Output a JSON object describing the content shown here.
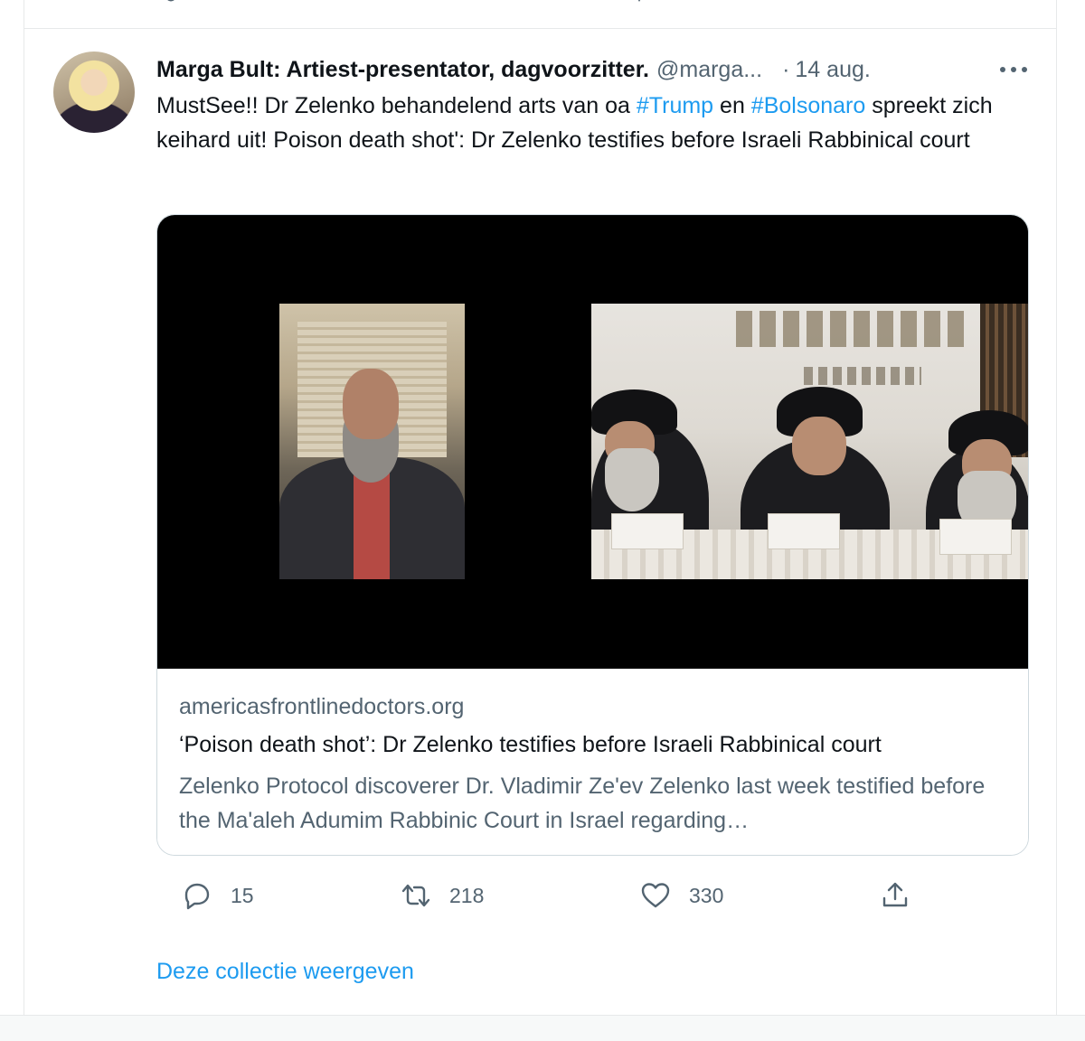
{
  "tweet": {
    "author_name": "Marga Bult: Artiest-presentator, dagvoorzitter.",
    "handle": "@marga...",
    "separator": "·",
    "date": "14 aug.",
    "text_segments": {
      "part1": "MustSee!! Dr Zelenko behandelend arts van oa ",
      "hashtag1": "#Trump",
      "part2": "  en ",
      "hashtag2": "#Bolsonaro",
      "part3": " spreekt zich keihard uit! Poison death shot': Dr Zelenko testifies before Israeli Rabbinical court"
    },
    "card": {
      "domain": "americasfrontlinedoctors.org",
      "title": "‘Poison death shot’: Dr Zelenko testifies before Israeli Rabbinical court",
      "description": " Zelenko Protocol discoverer Dr. Vladimir Ze'ev Zelenko last week testified before the Ma'aleh Adumim Rabbinic Court in Israel regarding…"
    },
    "actions": {
      "reply_icon": "reply-icon",
      "reply_count": "15",
      "retweet_icon": "retweet-icon",
      "retweet_count": "218",
      "like_icon": "heart-icon",
      "like_count": "330",
      "share_icon": "share-icon"
    },
    "show_collection": "Deze collectie weergeven"
  },
  "colors": {
    "link": "#1d9bf0",
    "secondary_text": "#536471",
    "primary_text": "#0f1419",
    "border": "#cfd9de"
  }
}
